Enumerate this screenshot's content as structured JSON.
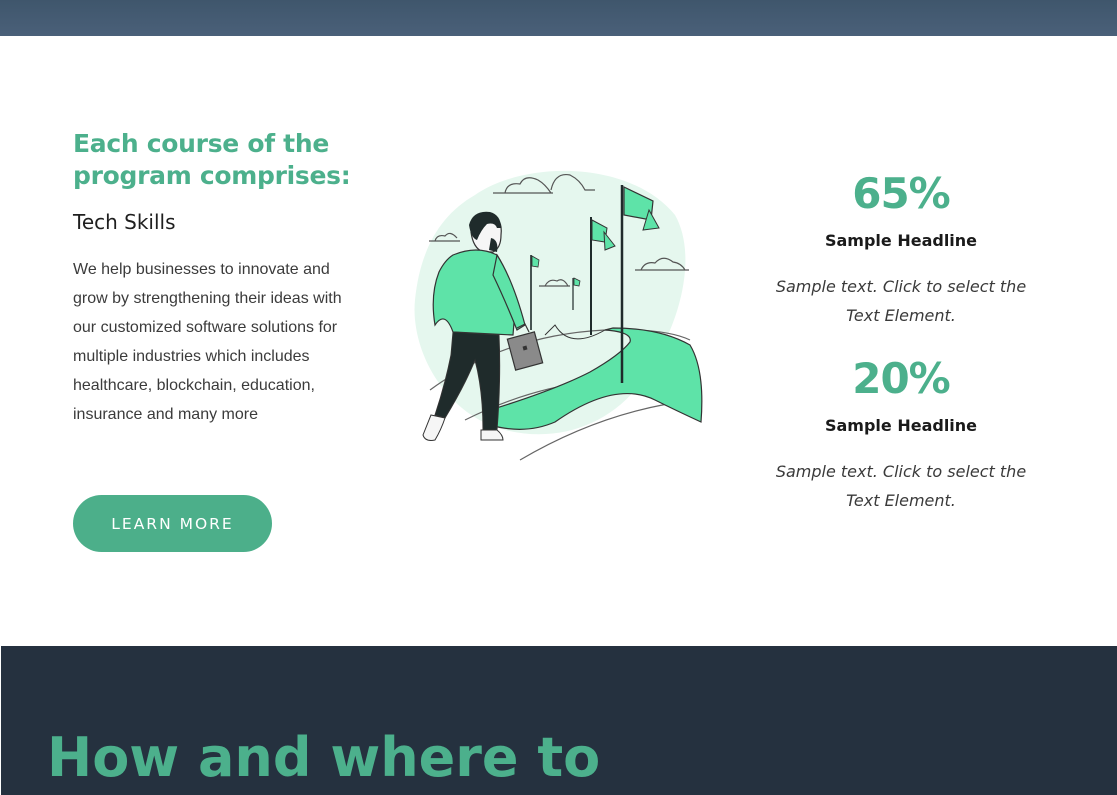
{
  "program": {
    "heading": "Each course of the program comprises:",
    "subheading": "Tech Skills",
    "body": "We help businesses to innovate and grow by strengthening their ideas with our customized software solutions for multiple industries which includes healthcare, blockchain, education, insurance and many more",
    "button_label": "LEARN MORE"
  },
  "stats": [
    {
      "value": "65%",
      "headline": "Sample Headline",
      "text": "Sample text. Click to select the Text Element."
    },
    {
      "value": "20%",
      "headline": "Sample Headline",
      "text": "Sample text. Click to select the Text Element."
    }
  ],
  "next_section": {
    "heading": "How and where to"
  },
  "colors": {
    "accent": "#4cb08c",
    "header_band": "#3f566c",
    "dark_section": "#25313f"
  },
  "illustration": {
    "icon": "businessman-walking-to-flags-illustration"
  }
}
